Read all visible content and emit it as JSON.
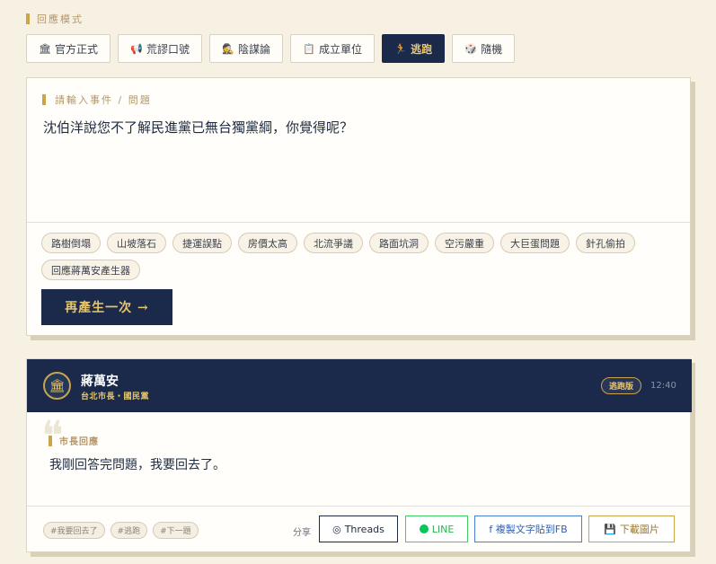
{
  "mode_section": {
    "label": "回應模式",
    "modes": [
      {
        "icon": "bank-icon",
        "glyph": "🏛",
        "label": "官方正式",
        "active": false
      },
      {
        "icon": "megaphone-icon",
        "glyph": "📢",
        "label": "荒謬口號",
        "active": false
      },
      {
        "icon": "detective-icon",
        "glyph": "🕵",
        "label": "陰謀論",
        "active": false
      },
      {
        "icon": "clipboard-icon",
        "glyph": "📋",
        "label": "成立單位",
        "active": false
      },
      {
        "icon": "running-icon",
        "glyph": "🏃",
        "label": "逃跑",
        "active": true
      },
      {
        "icon": "dice-icon",
        "glyph": "🎲",
        "label": "隨機",
        "active": false
      }
    ]
  },
  "input": {
    "label": "請輸入事件 / 問題",
    "question": "沈伯洋說您不了解民進黨已無台獨黨綱，你覺得呢？",
    "suggestions": [
      "路樹倒塌",
      "山坡落石",
      "捷運誤點",
      "房價太高",
      "北流爭議",
      "路面坑洞",
      "空污嚴重",
      "大巨蛋問題",
      "針孔偷拍",
      "回應蔣萬安產生器"
    ],
    "regenerate_label": "再產生一次 →"
  },
  "response": {
    "avatar_glyph": "🏛",
    "name": "蔣萬安",
    "role": "台北市長・國民黨",
    "mode_badge": "逃跑版",
    "time": "12:40",
    "quote_glyph": "❝",
    "label": "市長回應",
    "text": "我剛回答完問題，我要回去了。",
    "tags": [
      "#我要回去了",
      "#逃跑",
      "#下一題"
    ],
    "share_label": "分享",
    "share": {
      "threads": {
        "glyph": "◎",
        "label": "Threads"
      },
      "line": {
        "label": "LINE"
      },
      "fb": {
        "label": "f 複製文字貼到FB"
      },
      "download": {
        "glyph": "💾",
        "label": "下載圖片"
      }
    }
  },
  "colors": {
    "navy": "#1b2a4a",
    "gold": "#c9a449",
    "background": "#f7f1e3",
    "line_green": "#06c755",
    "fb_blue": "#4a7ed6"
  }
}
